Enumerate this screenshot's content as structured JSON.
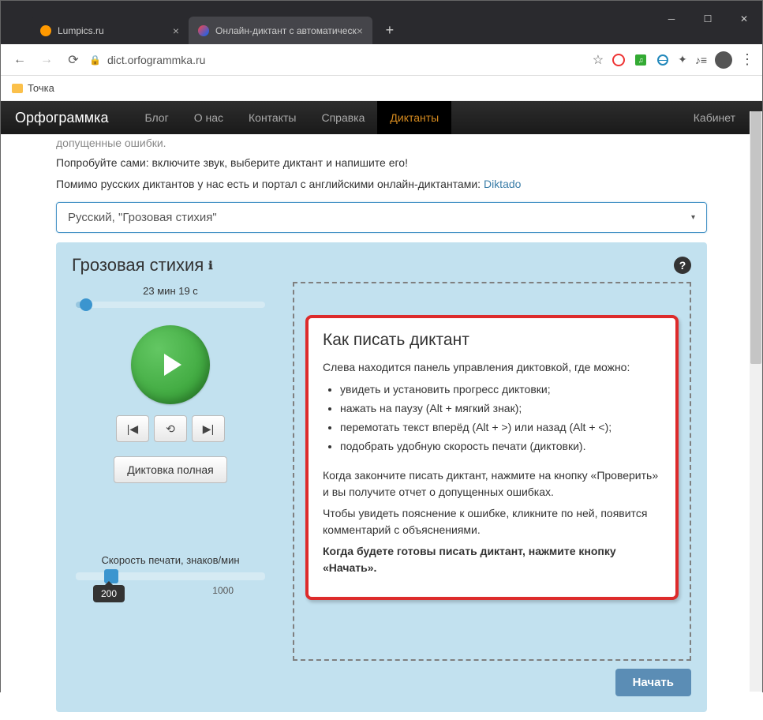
{
  "window": {
    "tab1": "Lumpics.ru",
    "tab2": "Онлайн-диктант с автоматическ"
  },
  "address": {
    "url": "dict.orfogrammka.ru"
  },
  "bookmarks": {
    "item1": "Точка"
  },
  "navbar": {
    "logo": "Орфограммка",
    "blog": "Блог",
    "about": "О нас",
    "contacts": "Контакты",
    "help": "Справка",
    "dictants": "Диктанты",
    "cabinet": "Кабинет"
  },
  "intro": {
    "line0": "допущенные ошибки.",
    "line1": "Попробуйте сами: включите звук, выберите диктант и напишите его!",
    "line2": "Помимо русских диктантов у нас есть и портал с английскими онлайн-диктантами: ",
    "link": "Diktado"
  },
  "select": {
    "value": "Русский, \"Грозовая стихия\""
  },
  "panel": {
    "title": "Грозовая стихия",
    "duration": "23 мин 19 с",
    "dict_full": "Диктовка полная",
    "speed_label": "Скорость печати, знаков/мин",
    "speed_value": "200",
    "speed_max": "1000"
  },
  "howto": {
    "title": "Как писать диктант",
    "p1": "Слева находится панель управления диктовкой, где можно:",
    "li1": "увидеть и установить прогресс диктовки;",
    "li2": "нажать на паузу (Alt + мягкий знак);",
    "li3": "перемотать текст вперёд (Alt + >) или назад (Alt + <);",
    "li4": "подобрать удобную скорость печати (диктовки).",
    "p2": "Когда закончите писать диктант, нажмите на кнопку «Проверить» и вы получите отчет о допущенных ошибках.",
    "p3": "Чтобы увидеть пояснение к ошибке, кликните по ней, появится комментарий с объяснениями.",
    "p4": "Когда будете готовы писать диктант, нажмите кнопку «Начать».",
    "start": "Начать"
  }
}
